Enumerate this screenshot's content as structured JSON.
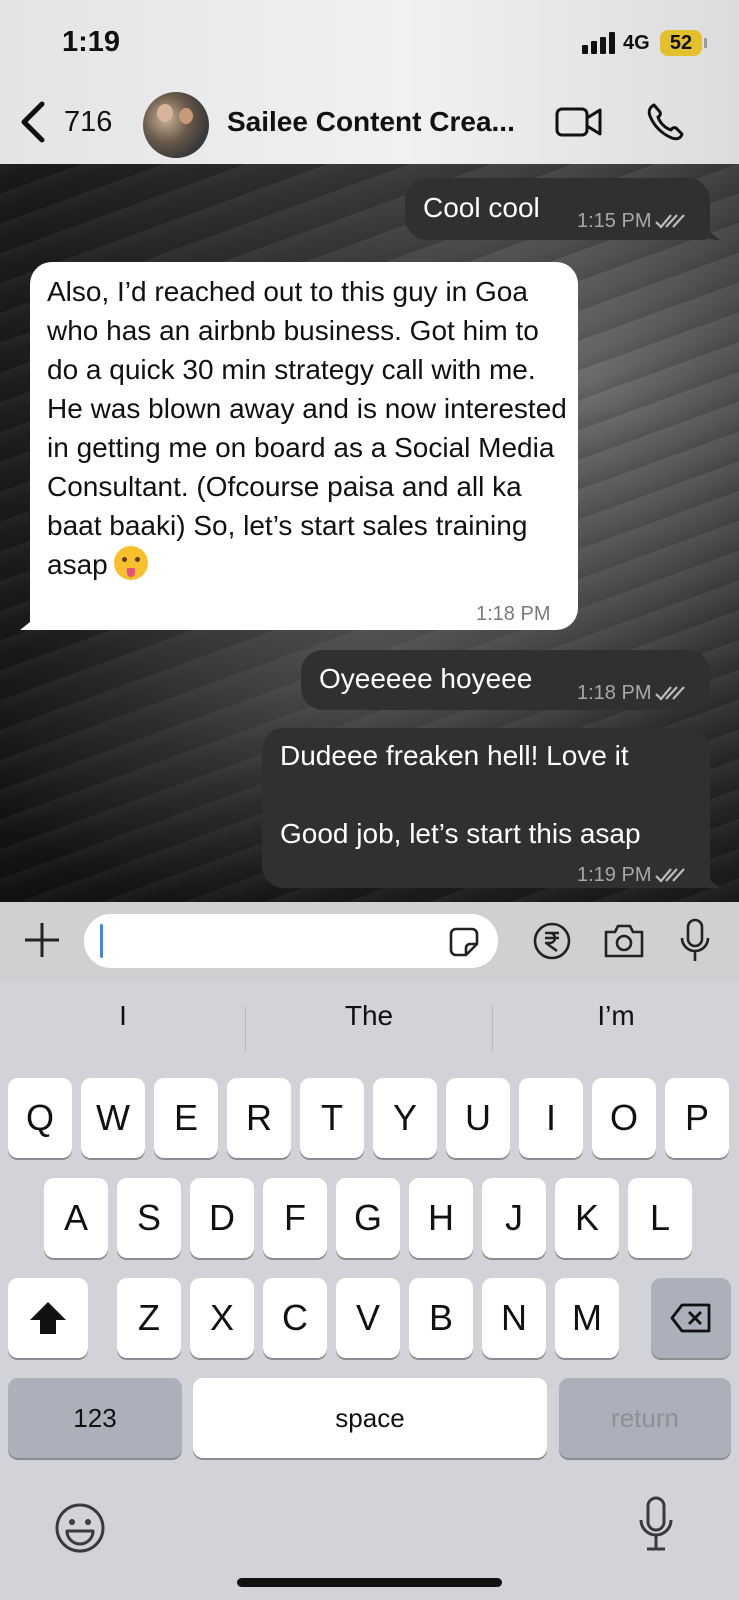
{
  "status_bar": {
    "time": "1:19",
    "network": "4G",
    "battery": "52"
  },
  "header": {
    "back_count": "716",
    "contact_name": "Sailee Content Crea..."
  },
  "messages": [
    {
      "direction": "out",
      "text": "Cool cool",
      "time": "1:15 PM",
      "read": true
    },
    {
      "direction": "in",
      "text": "Also, I’d reached out to this guy in Goa who has an airbnb business. Got him to do a quick 30 min strategy call with me. He was blown away and is now interested in getting me on board as a Social Media Consultant. (Ofcourse paisa and all ka baat baaki) So, let’s start sales training asap",
      "emoji": "face-with-tongue",
      "time": "1:18 PM"
    },
    {
      "direction": "out",
      "text": "Oyeeeee hoyeee",
      "time": "1:18 PM",
      "read": true
    },
    {
      "direction": "out",
      "line1": "Dudeee freaken hell! Love it",
      "line2": "Good job, let’s start this asap",
      "time": "1:19 PM",
      "read": true
    }
  ],
  "composer": {
    "value": ""
  },
  "keyboard": {
    "predictions": [
      "I",
      "The",
      "I’m"
    ],
    "row1": [
      "Q",
      "W",
      "E",
      "R",
      "T",
      "Y",
      "U",
      "I",
      "O",
      "P"
    ],
    "row2": [
      "A",
      "S",
      "D",
      "F",
      "G",
      "H",
      "J",
      "K",
      "L"
    ],
    "row3": [
      "Z",
      "X",
      "C",
      "V",
      "B",
      "N",
      "M"
    ],
    "numbers_label": "123",
    "space_label": "space",
    "return_label": "return"
  },
  "colors": {
    "incoming_bubble": "#ffffff",
    "outgoing_bubble": "#2f3032",
    "battery": "#e3c02e",
    "caret": "#3b8ae6"
  }
}
